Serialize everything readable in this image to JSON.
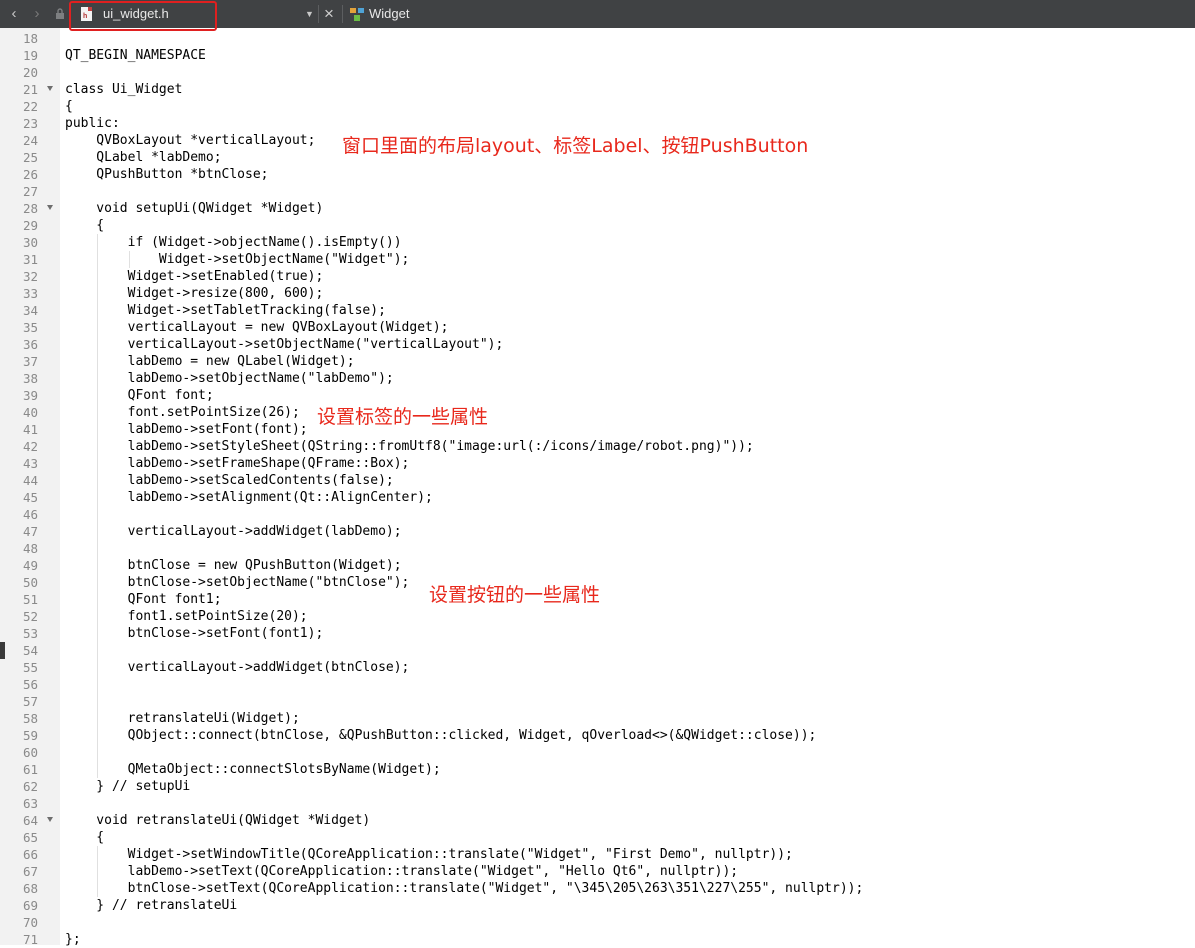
{
  "toolbar": {
    "back_icon": "chevron-left",
    "forward_icon": "chevron-right",
    "lock_icon": "lock",
    "file_tab_label": "ui_widget.h",
    "file_icon_badge": "h",
    "dropdown_icon": "triangle-down",
    "close_glyph": "×",
    "symbol_label": "Widget",
    "symbol_icon": "class-icon"
  },
  "editor": {
    "lines": [
      {
        "n": "18",
        "t": ""
      },
      {
        "n": "19",
        "t": "QT_BEGIN_NAMESPACE"
      },
      {
        "n": "20",
        "t": ""
      },
      {
        "n": "21",
        "t": "class Ui_Widget",
        "fold": true
      },
      {
        "n": "22",
        "t": "{"
      },
      {
        "n": "23",
        "t": "public:"
      },
      {
        "n": "24",
        "t": "    QVBoxLayout *verticalLayout;"
      },
      {
        "n": "25",
        "t": "    QLabel *labDemo;"
      },
      {
        "n": "26",
        "t": "    QPushButton *btnClose;"
      },
      {
        "n": "27",
        "t": ""
      },
      {
        "n": "28",
        "t": "    void setupUi(QWidget *Widget)",
        "fold": true
      },
      {
        "n": "29",
        "t": "    {"
      },
      {
        "n": "30",
        "t": "        if (Widget->objectName().isEmpty())"
      },
      {
        "n": "31",
        "t": "            Widget->setObjectName(\"Widget\");"
      },
      {
        "n": "32",
        "t": "        Widget->setEnabled(true);"
      },
      {
        "n": "33",
        "t": "        Widget->resize(800, 600);"
      },
      {
        "n": "34",
        "t": "        Widget->setTabletTracking(false);"
      },
      {
        "n": "35",
        "t": "        verticalLayout = new QVBoxLayout(Widget);"
      },
      {
        "n": "36",
        "t": "        verticalLayout->setObjectName(\"verticalLayout\");"
      },
      {
        "n": "37",
        "t": "        labDemo = new QLabel(Widget);"
      },
      {
        "n": "38",
        "t": "        labDemo->setObjectName(\"labDemo\");"
      },
      {
        "n": "39",
        "t": "        QFont font;"
      },
      {
        "n": "40",
        "t": "        font.setPointSize(26);"
      },
      {
        "n": "41",
        "t": "        labDemo->setFont(font);"
      },
      {
        "n": "42",
        "t": "        labDemo->setStyleSheet(QString::fromUtf8(\"image:url(:/icons/image/robot.png)\"));"
      },
      {
        "n": "43",
        "t": "        labDemo->setFrameShape(QFrame::Box);"
      },
      {
        "n": "44",
        "t": "        labDemo->setScaledContents(false);"
      },
      {
        "n": "45",
        "t": "        labDemo->setAlignment(Qt::AlignCenter);"
      },
      {
        "n": "46",
        "t": ""
      },
      {
        "n": "47",
        "t": "        verticalLayout->addWidget(labDemo);"
      },
      {
        "n": "48",
        "t": ""
      },
      {
        "n": "49",
        "t": "        btnClose = new QPushButton(Widget);"
      },
      {
        "n": "50",
        "t": "        btnClose->setObjectName(\"btnClose\");"
      },
      {
        "n": "51",
        "t": "        QFont font1;"
      },
      {
        "n": "52",
        "t": "        font1.setPointSize(20);"
      },
      {
        "n": "53",
        "t": "        btnClose->setFont(font1);"
      },
      {
        "n": "54",
        "t": "",
        "marker": true
      },
      {
        "n": "55",
        "t": "        verticalLayout->addWidget(btnClose);"
      },
      {
        "n": "56",
        "t": ""
      },
      {
        "n": "57",
        "t": ""
      },
      {
        "n": "58",
        "t": "        retranslateUi(Widget);"
      },
      {
        "n": "59",
        "t": "        QObject::connect(btnClose, &QPushButton::clicked, Widget, qOverload<>(&QWidget::close));"
      },
      {
        "n": "60",
        "t": ""
      },
      {
        "n": "61",
        "t": "        QMetaObject::connectSlotsByName(Widget);"
      },
      {
        "n": "62",
        "t": "    } // setupUi"
      },
      {
        "n": "63",
        "t": ""
      },
      {
        "n": "64",
        "t": "    void retranslateUi(QWidget *Widget)",
        "fold": true
      },
      {
        "n": "65",
        "t": "    {"
      },
      {
        "n": "66",
        "t": "        Widget->setWindowTitle(QCoreApplication::translate(\"Widget\", \"First Demo\", nullptr));"
      },
      {
        "n": "67",
        "t": "        labDemo->setText(QCoreApplication::translate(\"Widget\", \"Hello Qt6\", nullptr));"
      },
      {
        "n": "68",
        "t": "        btnClose->setText(QCoreApplication::translate(\"Widget\", \"\\345\\205\\263\\351\\227\\255\", nullptr));"
      },
      {
        "n": "69",
        "t": "    } // retranslateUi"
      },
      {
        "n": "70",
        "t": ""
      },
      {
        "n": "71",
        "t": "};"
      }
    ]
  },
  "annotations": {
    "layout_note": "窗口里面的布局layout、标签Label、按钮PushButton",
    "label_note": "设置标签的一些属性",
    "button_note": "设置按钮的一些属性"
  },
  "colors": {
    "toolbar_bg": "#404244",
    "gutter_bg": "#f2f2f2",
    "annotation": "#e8281c",
    "tab_highlight": "#e02020"
  }
}
